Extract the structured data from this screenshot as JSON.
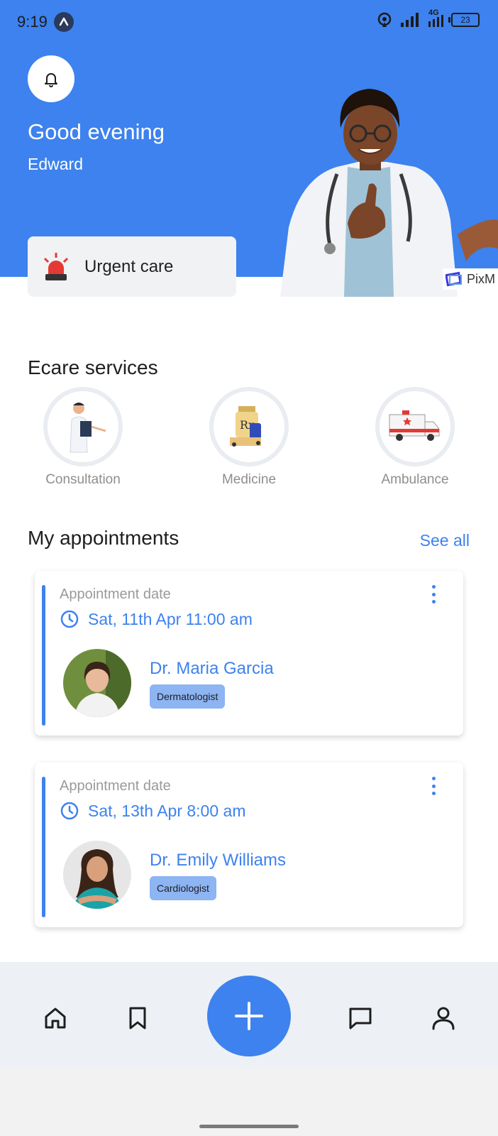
{
  "status_bar": {
    "time": "9:19",
    "network": "4G",
    "battery": "23"
  },
  "header": {
    "greeting": "Good evening",
    "username": "Edward",
    "urgent_care_label": "Urgent care",
    "watermark": "PixM"
  },
  "services": {
    "title": "Ecare services",
    "items": [
      {
        "label": "Consultation",
        "icon": "doctor-consultation-icon"
      },
      {
        "label": "Medicine",
        "icon": "medicine-icon"
      },
      {
        "label": "Ambulance",
        "icon": "ambulance-icon"
      }
    ]
  },
  "appointments": {
    "title": "My appointments",
    "see_all": "See all",
    "items": [
      {
        "date_label": "Appointment date",
        "date_time": "Sat, 11th Apr 11:00 am",
        "doctor": "Dr. Maria Garcia",
        "specialty": "Dermatologist"
      },
      {
        "date_label": "Appointment date",
        "date_time": "Sat, 13th Apr 8:00 am",
        "doctor": "Dr. Emily Williams",
        "specialty": "Cardiologist"
      }
    ]
  },
  "bottom_nav": {
    "items": [
      "home-icon",
      "bookmark-icon",
      "add-icon",
      "chat-icon",
      "profile-icon"
    ]
  },
  "colors": {
    "primary": "#3d82ee",
    "chip": "#8db4f3",
    "nav_bg": "#edf0f4"
  }
}
